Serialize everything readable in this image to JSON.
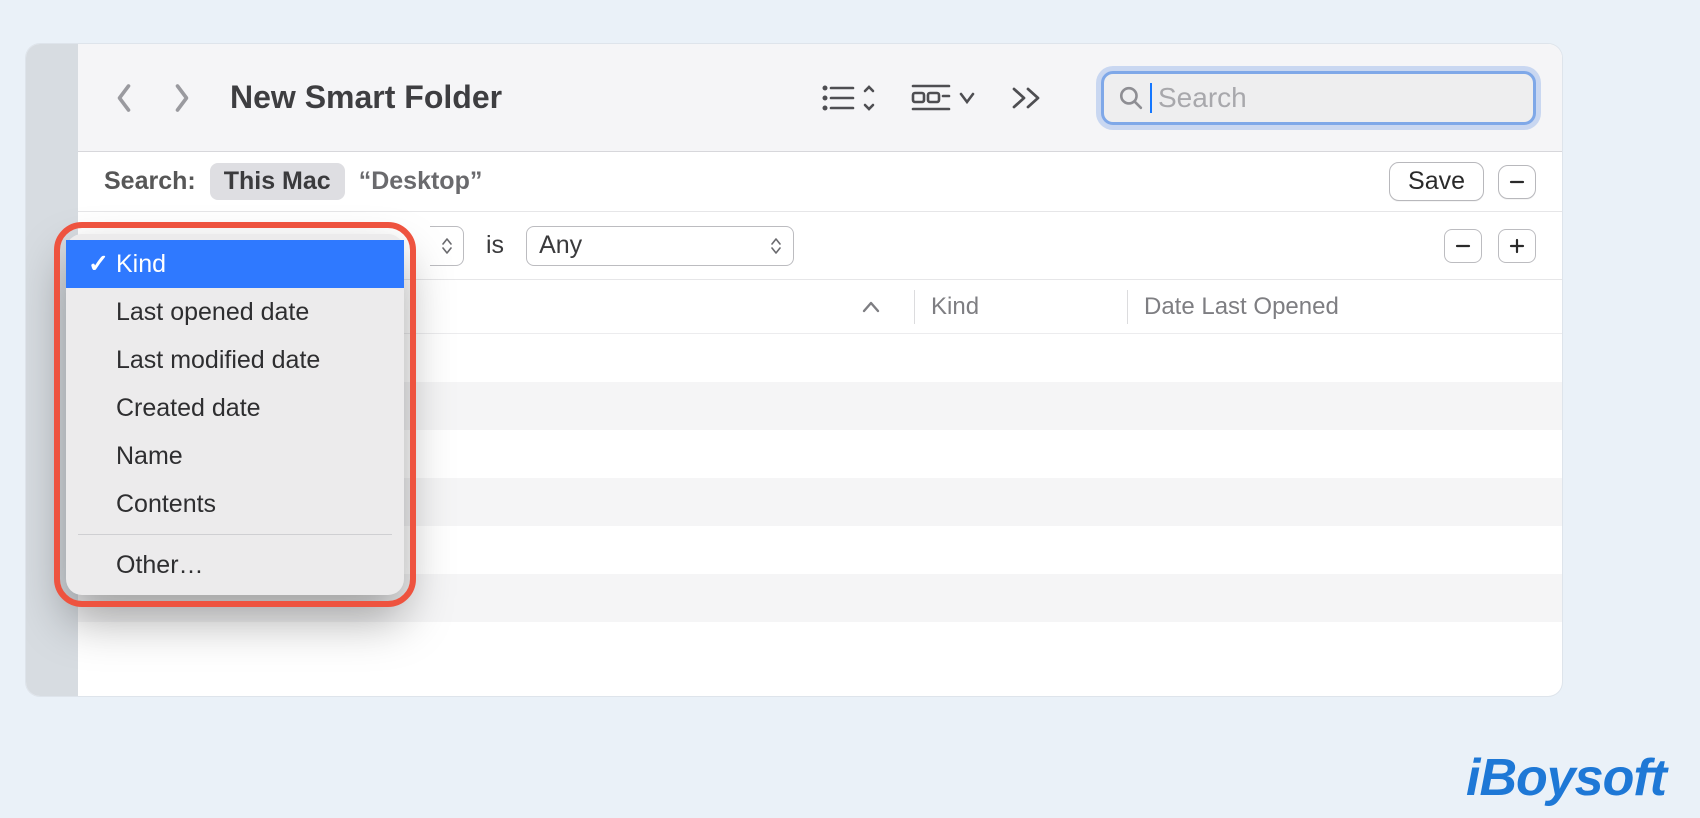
{
  "toolbar": {
    "title": "New Smart Folder",
    "search_placeholder": "Search"
  },
  "scope": {
    "label": "Search:",
    "active": "This Mac",
    "option": "“Desktop”",
    "save_label": "Save"
  },
  "criteria": {
    "is_label": "is",
    "value_select": "Any"
  },
  "columns": {
    "kind": "Kind",
    "date": "Date Last Opened"
  },
  "popup": {
    "items": [
      "Kind",
      "Last opened date",
      "Last modified date",
      "Created date",
      "Name",
      "Contents"
    ],
    "other": "Other…",
    "selected_index": 0
  },
  "watermark": "iBoysoft"
}
